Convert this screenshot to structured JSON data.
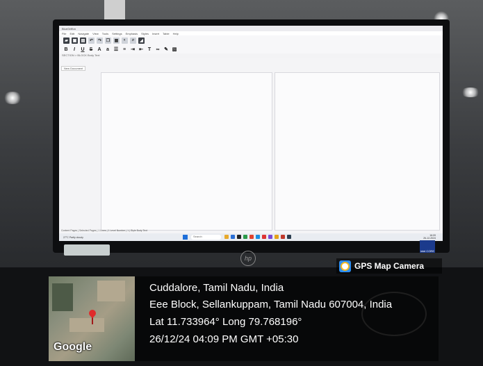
{
  "app": {
    "titlebar": "BlueGriffon",
    "menu": [
      "File",
      "Edit",
      "Navigate",
      "View",
      "Tools",
      "Settings",
      "Emphasis",
      "Styles",
      "Insert",
      "Table",
      "Help"
    ],
    "breadcrumb": "SECTION > BLOCK Body Text",
    "doc_tab": "New Document",
    "status": "Content Pages | Selected Pages | 1 Lines | 1 Level Number | 1 | Style Body Text"
  },
  "taskbar": {
    "weather_temp": "27°C",
    "weather_desc": "Partly cloudy",
    "search_placeholder": "Search",
    "time": "16:09",
    "date": "26-12-2024"
  },
  "bezel": {
    "brand": "hp",
    "badge": "intel CORE"
  },
  "overlay": {
    "app_name": "GPS Map Camera",
    "city": "Cuddalore, Tamil Nadu, India",
    "address": "Eee Block, Sellankuppam, Tamil Nadu 607004, India",
    "coords": "Lat 11.733964° Long 79.768196°",
    "timestamp": "26/12/24 04:09 PM GMT +05:30",
    "map_label": "Google"
  },
  "colors": {
    "gps_accent": "#2d8ef0",
    "pin": "#e02b2b",
    "start": "#1e6fd9"
  }
}
